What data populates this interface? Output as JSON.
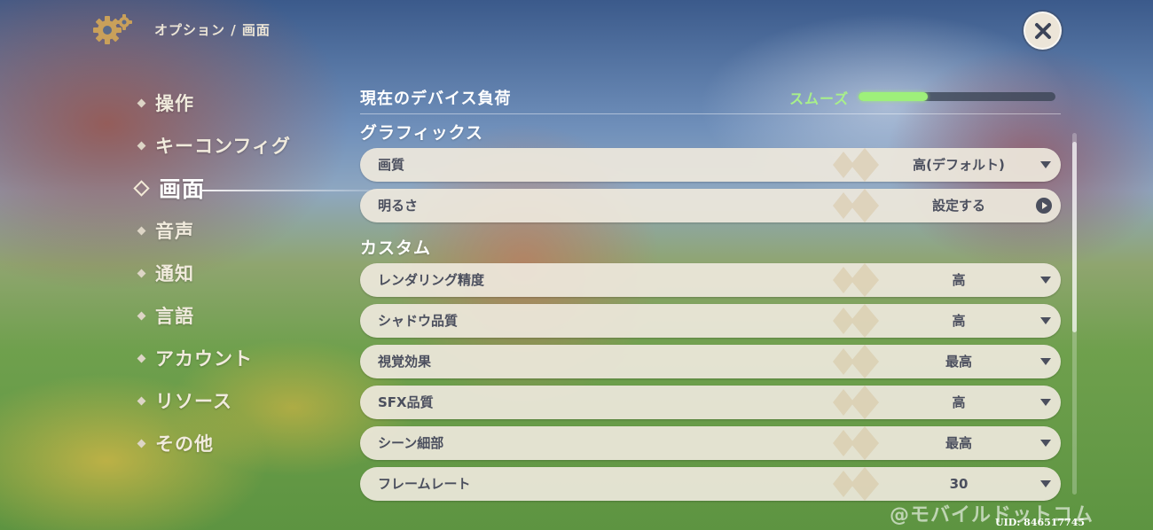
{
  "header": {
    "icon": "gear-icon",
    "breadcrumb": "オプション / 画面",
    "close_icon": "close-icon"
  },
  "sidebar": {
    "items": [
      {
        "label": "操作",
        "active": false
      },
      {
        "label": "キーコンフィグ",
        "active": false
      },
      {
        "label": "画面",
        "active": true
      },
      {
        "label": "音声",
        "active": false
      },
      {
        "label": "通知",
        "active": false
      },
      {
        "label": "言語",
        "active": false
      },
      {
        "label": "アカウント",
        "active": false
      },
      {
        "label": "リソース",
        "active": false
      },
      {
        "label": "その他",
        "active": false
      }
    ]
  },
  "device_load": {
    "title": "現在のデバイス負荷",
    "status": "スムーズ",
    "status_color": "#a8f08a",
    "level": 0.35
  },
  "graphics": {
    "title": "グラフィックス",
    "rows": [
      {
        "label": "画質",
        "value": "高(デフォルト)",
        "control": "dropdown"
      },
      {
        "label": "明るさ",
        "value": "設定する",
        "control": "navigate"
      }
    ]
  },
  "custom": {
    "title": "カスタム",
    "rows": [
      {
        "label": "レンダリング精度",
        "value": "高",
        "control": "dropdown"
      },
      {
        "label": "シャドウ品質",
        "value": "高",
        "control": "dropdown"
      },
      {
        "label": "視覚効果",
        "value": "最高",
        "control": "dropdown"
      },
      {
        "label": "SFX品質",
        "value": "高",
        "control": "dropdown"
      },
      {
        "label": "シーン細部",
        "value": "最高",
        "control": "dropdown"
      },
      {
        "label": "フレームレート",
        "value": "30",
        "control": "dropdown"
      }
    ]
  },
  "footer": {
    "watermark": "@モバイルドットコム",
    "uid": "UID: 846517745"
  }
}
